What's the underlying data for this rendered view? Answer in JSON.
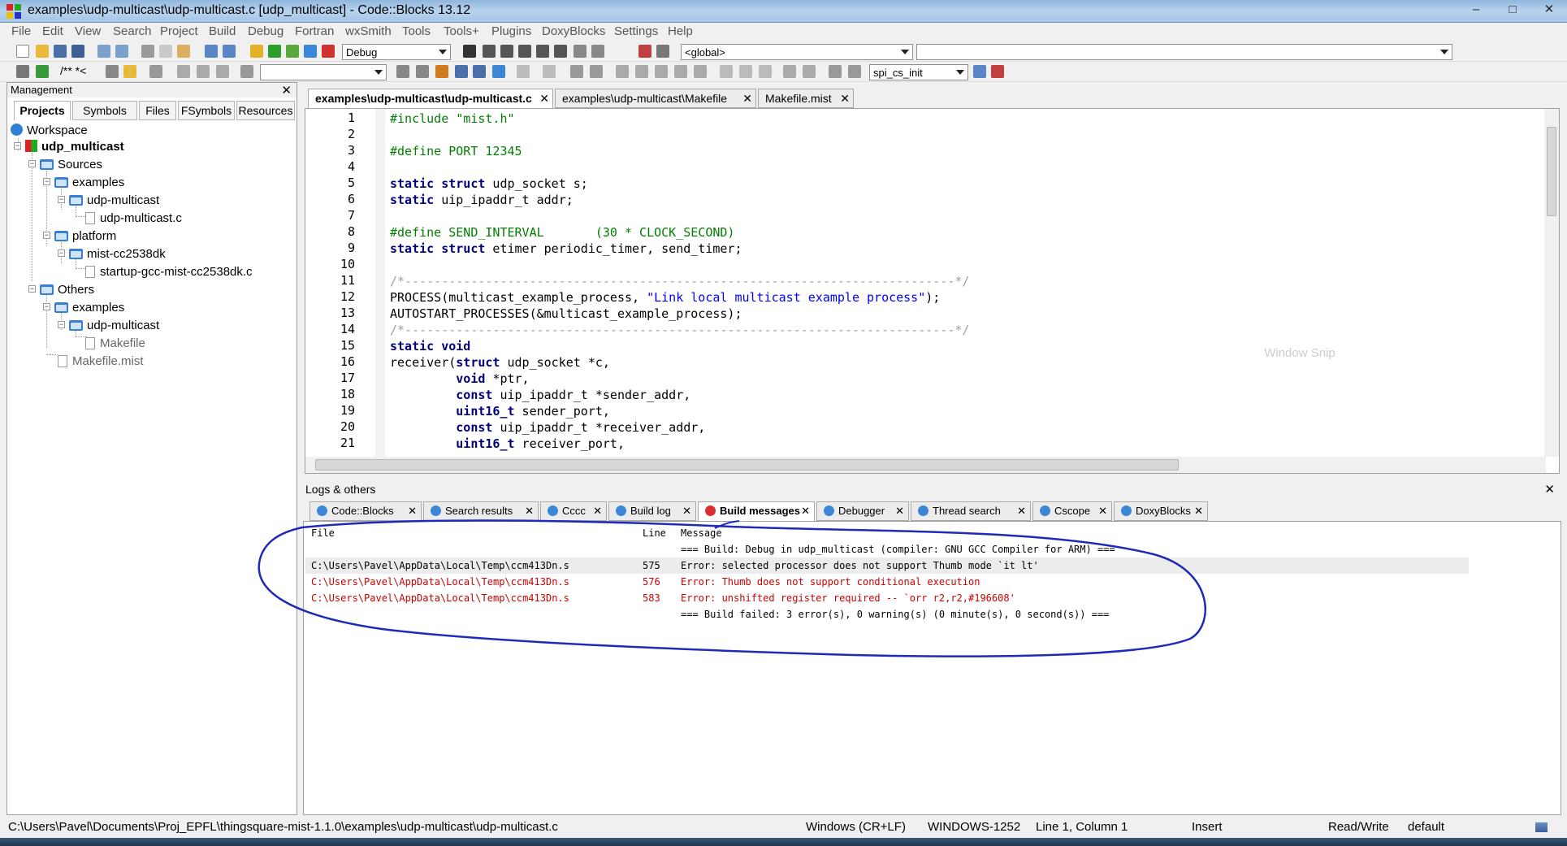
{
  "window": {
    "title": "examples\\udp-multicast\\udp-multicast.c [udp_multicast] - Code::Blocks 13.12",
    "buttons": {
      "minimize": "–",
      "maximize": "□",
      "close": "✕"
    }
  },
  "menu": [
    "File",
    "Edit",
    "View",
    "Search",
    "Project",
    "Build",
    "Debug",
    "Fortran",
    "wxSmith",
    "Tools",
    "Tools+",
    "Plugins",
    "DoxyBlocks",
    "Settings",
    "Help"
  ],
  "toolbar": {
    "build_target": "Debug",
    "scope": "<global>",
    "function": "",
    "search_combo": "",
    "symbol_combo": "spi_cs_init",
    "comment_labels": "/** *<"
  },
  "management": {
    "title": "Management",
    "close": "✕",
    "tabs": [
      "Projects",
      "Symbols",
      "Files",
      "FSymbols",
      "Resources"
    ],
    "active_tab": "Projects",
    "tree": {
      "workspace": "Workspace",
      "project": "udp_multicast",
      "sources": "Sources",
      "src_examples": "examples",
      "src_udp": "udp-multicast",
      "src_file": "udp-multicast.c",
      "platform": "platform",
      "platform_dir": "mist-cc2538dk",
      "platform_file": "startup-gcc-mist-cc2538dk.c",
      "others": "Others",
      "oth_examples": "examples",
      "oth_udp": "udp-multicast",
      "oth_makefile": "Makefile",
      "oth_makefile_mist": "Makefile.mist"
    }
  },
  "editor": {
    "tabs": [
      {
        "label": "examples\\udp-multicast\\udp-multicast.c",
        "active": true
      },
      {
        "label": "examples\\udp-multicast\\Makefile",
        "active": false
      },
      {
        "label": "Makefile.mist",
        "active": false
      }
    ],
    "tab_close": "✕",
    "line_numbers": [
      "1",
      "2",
      "3",
      "4",
      "5",
      "6",
      "7",
      "8",
      "9",
      "10",
      "11",
      "12",
      "13",
      "14",
      "15",
      "16",
      "17",
      "18",
      "19",
      "20",
      "21"
    ],
    "lines": {
      "l1": "#include \"mist.h\"",
      "l3": "#define PORT 12345",
      "l5a": "static struct",
      "l5b": " udp_socket s;",
      "l6a": "static",
      "l6b": " uip_ipaddr_t addr;",
      "l8a": "#define SEND_INTERVAL",
      "l8b": "       (30 * CLOCK_SECOND)",
      "l9a": "static struct",
      "l9b": " etimer periodic_timer, send_timer;",
      "l11": "/*---------------------------------------------------------------------------*/",
      "l12a": "PROCESS(multicast_example_process, ",
      "l12b": "\"Link local multicast example process\"",
      "l12c": ");",
      "l13": "AUTOSTART_PROCESSES(&multicast_example_process);",
      "l14": "/*---------------------------------------------------------------------------*/",
      "l15": "static void",
      "l16a": "receiver(",
      "l16b": "struct",
      "l16c": " udp_socket *c,",
      "l17a": "         void",
      "l17b": " *ptr,",
      "l18a": "         const",
      "l18b": " uip_ipaddr_t *sender_addr,",
      "l19a": "         uint16_t",
      "l19b": " sender_port,",
      "l20a": "         const",
      "l20b": " uip_ipaddr_t *receiver_addr,",
      "l21a": "         uint16_t",
      "l21b": " receiver_port,"
    }
  },
  "overlay": {
    "snip": "Window Snip"
  },
  "logs": {
    "title": "Logs & others",
    "close": "✕",
    "tabs": [
      {
        "label": "Code::Blocks",
        "active": false
      },
      {
        "label": "Search results",
        "active": false
      },
      {
        "label": "Cccc",
        "active": false
      },
      {
        "label": "Build log",
        "active": false
      },
      {
        "label": "Build messages",
        "active": true
      },
      {
        "label": "Debugger",
        "active": false
      },
      {
        "label": "Thread search",
        "active": false
      },
      {
        "label": "Cscope",
        "active": false
      },
      {
        "label": "DoxyBlocks",
        "active": false
      }
    ],
    "headers": {
      "file": "File",
      "line": "Line",
      "message": "Message"
    },
    "rows": [
      {
        "file": "",
        "line": "",
        "message": "=== Build: Debug in udp_multicast (compiler: GNU GCC Compiler for ARM) ==="
      },
      {
        "file": "C:\\Users\\Pavel\\AppData\\Local\\Temp\\ccm413Dn.s",
        "line": "575",
        "message": "Error: selected processor does not support Thumb mode `it lt'"
      },
      {
        "file": "C:\\Users\\Pavel\\AppData\\Local\\Temp\\ccm413Dn.s",
        "line": "576",
        "message": "Error: Thumb does not support conditional execution"
      },
      {
        "file": "C:\\Users\\Pavel\\AppData\\Local\\Temp\\ccm413Dn.s",
        "line": "583",
        "message": "Error: unshifted register required -- `orr r2,r2,#196608'"
      },
      {
        "file": "",
        "line": "",
        "message": "=== Build failed: 3 error(s), 0 warning(s) (0 minute(s), 0 second(s)) ==="
      }
    ]
  },
  "status": {
    "path": "C:\\Users\\Pavel\\Documents\\Proj_EPFL\\thingsquare-mist-1.1.0\\examples\\udp-multicast\\udp-multicast.c",
    "eol": "Windows (CR+LF)",
    "encoding": "WINDOWS-1252",
    "position": "Line 1, Column 1",
    "mode": "Insert",
    "access": "Read/Write",
    "highlight": "default"
  },
  "colors": {
    "error": "#cc0000",
    "keyword": "#00007f",
    "preproc": "#007f00",
    "string": "#0000ff",
    "annotation": "#1f2ab8"
  }
}
